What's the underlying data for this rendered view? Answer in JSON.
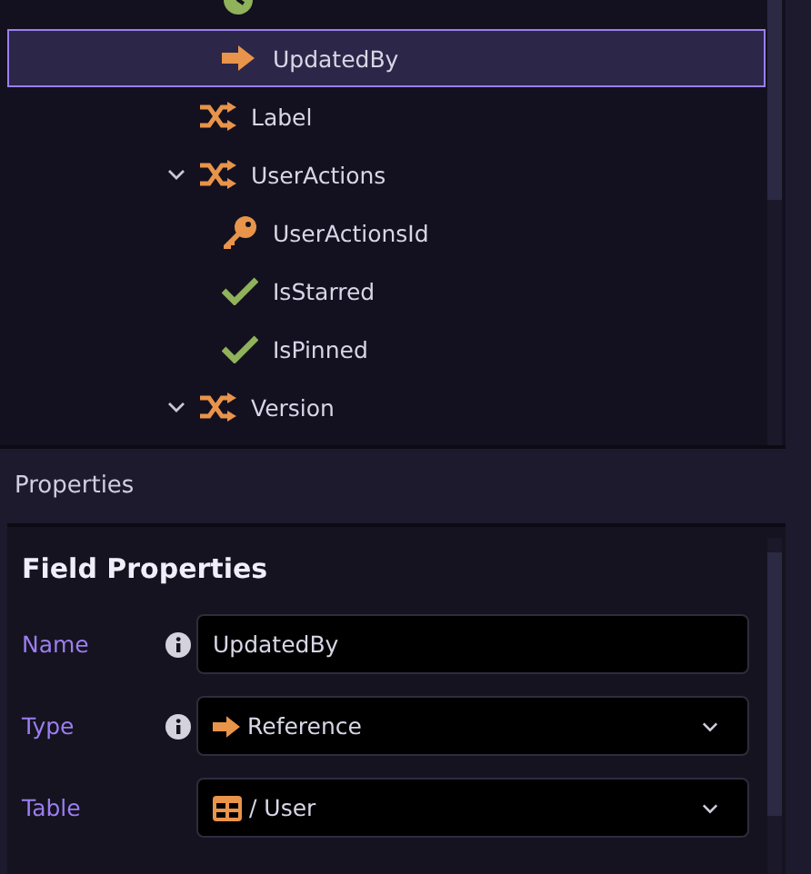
{
  "tree": {
    "items": [
      {
        "children": [
          {
            "kind": "clock",
            "selected": false
          },
          {
            "label": "UpdatedBy",
            "kind": "reference",
            "selected": true
          }
        ]
      },
      {
        "label": "Label",
        "kind": "object",
        "selected": false
      },
      {
        "label": "UserActions",
        "kind": "object",
        "selected": false,
        "expanded": true,
        "children": [
          {
            "label": "UserActionsId",
            "kind": "key",
            "selected": false
          },
          {
            "label": "IsStarred",
            "kind": "boolean",
            "selected": false
          },
          {
            "label": "IsPinned",
            "kind": "boolean",
            "selected": false
          }
        ]
      },
      {
        "label": "Version",
        "kind": "object",
        "selected": false,
        "expanded": true
      }
    ]
  },
  "properties": {
    "header": "Properties",
    "title": "Field Properties",
    "fields": [
      {
        "label": "Name",
        "info": true,
        "kind": "text",
        "value": "UpdatedBy"
      },
      {
        "label": "Type",
        "info": true,
        "kind": "type",
        "value": "Reference"
      },
      {
        "label": "Table",
        "info": false,
        "kind": "table",
        "value": "/ User"
      }
    ]
  }
}
